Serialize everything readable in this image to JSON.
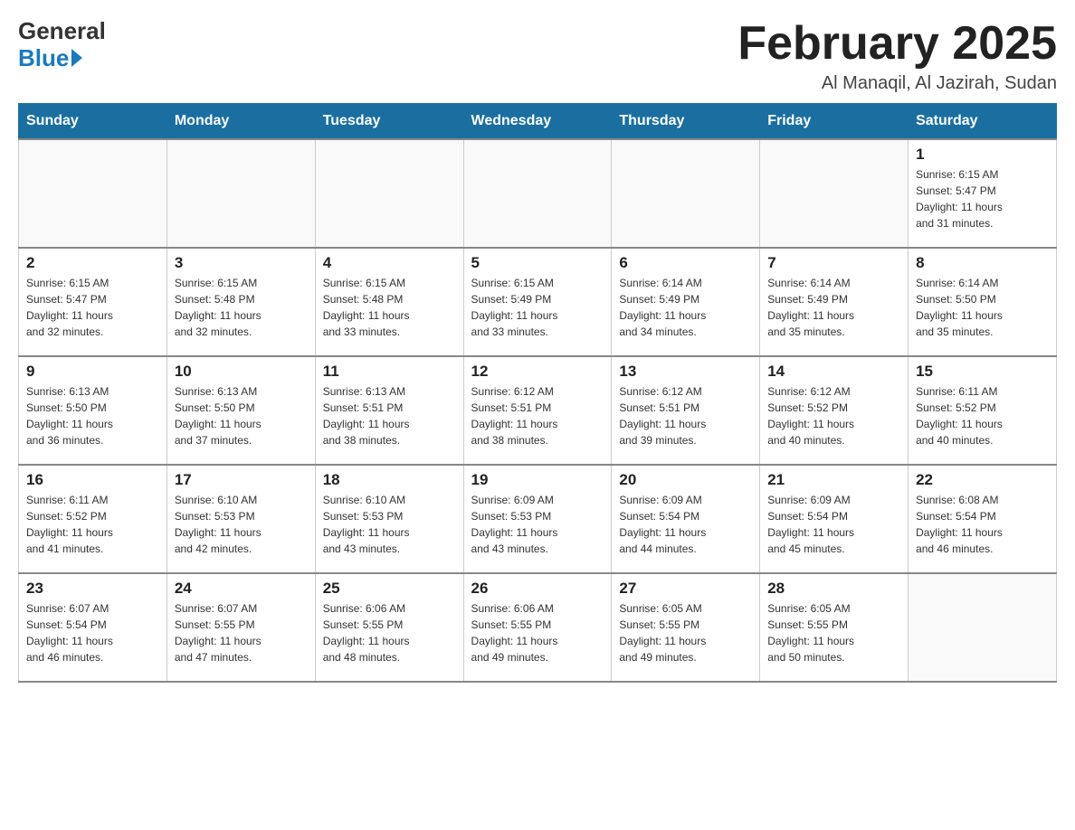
{
  "header": {
    "logo_general": "General",
    "logo_blue": "Blue",
    "month_title": "February 2025",
    "location": "Al Manaqil, Al Jazirah, Sudan"
  },
  "days_of_week": [
    "Sunday",
    "Monday",
    "Tuesday",
    "Wednesday",
    "Thursday",
    "Friday",
    "Saturday"
  ],
  "weeks": [
    [
      {
        "day": "",
        "info": ""
      },
      {
        "day": "",
        "info": ""
      },
      {
        "day": "",
        "info": ""
      },
      {
        "day": "",
        "info": ""
      },
      {
        "day": "",
        "info": ""
      },
      {
        "day": "",
        "info": ""
      },
      {
        "day": "1",
        "info": "Sunrise: 6:15 AM\nSunset: 5:47 PM\nDaylight: 11 hours\nand 31 minutes."
      }
    ],
    [
      {
        "day": "2",
        "info": "Sunrise: 6:15 AM\nSunset: 5:47 PM\nDaylight: 11 hours\nand 32 minutes."
      },
      {
        "day": "3",
        "info": "Sunrise: 6:15 AM\nSunset: 5:48 PM\nDaylight: 11 hours\nand 32 minutes."
      },
      {
        "day": "4",
        "info": "Sunrise: 6:15 AM\nSunset: 5:48 PM\nDaylight: 11 hours\nand 33 minutes."
      },
      {
        "day": "5",
        "info": "Sunrise: 6:15 AM\nSunset: 5:49 PM\nDaylight: 11 hours\nand 33 minutes."
      },
      {
        "day": "6",
        "info": "Sunrise: 6:14 AM\nSunset: 5:49 PM\nDaylight: 11 hours\nand 34 minutes."
      },
      {
        "day": "7",
        "info": "Sunrise: 6:14 AM\nSunset: 5:49 PM\nDaylight: 11 hours\nand 35 minutes."
      },
      {
        "day": "8",
        "info": "Sunrise: 6:14 AM\nSunset: 5:50 PM\nDaylight: 11 hours\nand 35 minutes."
      }
    ],
    [
      {
        "day": "9",
        "info": "Sunrise: 6:13 AM\nSunset: 5:50 PM\nDaylight: 11 hours\nand 36 minutes."
      },
      {
        "day": "10",
        "info": "Sunrise: 6:13 AM\nSunset: 5:50 PM\nDaylight: 11 hours\nand 37 minutes."
      },
      {
        "day": "11",
        "info": "Sunrise: 6:13 AM\nSunset: 5:51 PM\nDaylight: 11 hours\nand 38 minutes."
      },
      {
        "day": "12",
        "info": "Sunrise: 6:12 AM\nSunset: 5:51 PM\nDaylight: 11 hours\nand 38 minutes."
      },
      {
        "day": "13",
        "info": "Sunrise: 6:12 AM\nSunset: 5:51 PM\nDaylight: 11 hours\nand 39 minutes."
      },
      {
        "day": "14",
        "info": "Sunrise: 6:12 AM\nSunset: 5:52 PM\nDaylight: 11 hours\nand 40 minutes."
      },
      {
        "day": "15",
        "info": "Sunrise: 6:11 AM\nSunset: 5:52 PM\nDaylight: 11 hours\nand 40 minutes."
      }
    ],
    [
      {
        "day": "16",
        "info": "Sunrise: 6:11 AM\nSunset: 5:52 PM\nDaylight: 11 hours\nand 41 minutes."
      },
      {
        "day": "17",
        "info": "Sunrise: 6:10 AM\nSunset: 5:53 PM\nDaylight: 11 hours\nand 42 minutes."
      },
      {
        "day": "18",
        "info": "Sunrise: 6:10 AM\nSunset: 5:53 PM\nDaylight: 11 hours\nand 43 minutes."
      },
      {
        "day": "19",
        "info": "Sunrise: 6:09 AM\nSunset: 5:53 PM\nDaylight: 11 hours\nand 43 minutes."
      },
      {
        "day": "20",
        "info": "Sunrise: 6:09 AM\nSunset: 5:54 PM\nDaylight: 11 hours\nand 44 minutes."
      },
      {
        "day": "21",
        "info": "Sunrise: 6:09 AM\nSunset: 5:54 PM\nDaylight: 11 hours\nand 45 minutes."
      },
      {
        "day": "22",
        "info": "Sunrise: 6:08 AM\nSunset: 5:54 PM\nDaylight: 11 hours\nand 46 minutes."
      }
    ],
    [
      {
        "day": "23",
        "info": "Sunrise: 6:07 AM\nSunset: 5:54 PM\nDaylight: 11 hours\nand 46 minutes."
      },
      {
        "day": "24",
        "info": "Sunrise: 6:07 AM\nSunset: 5:55 PM\nDaylight: 11 hours\nand 47 minutes."
      },
      {
        "day": "25",
        "info": "Sunrise: 6:06 AM\nSunset: 5:55 PM\nDaylight: 11 hours\nand 48 minutes."
      },
      {
        "day": "26",
        "info": "Sunrise: 6:06 AM\nSunset: 5:55 PM\nDaylight: 11 hours\nand 49 minutes."
      },
      {
        "day": "27",
        "info": "Sunrise: 6:05 AM\nSunset: 5:55 PM\nDaylight: 11 hours\nand 49 minutes."
      },
      {
        "day": "28",
        "info": "Sunrise: 6:05 AM\nSunset: 5:55 PM\nDaylight: 11 hours\nand 50 minutes."
      },
      {
        "day": "",
        "info": ""
      }
    ]
  ]
}
